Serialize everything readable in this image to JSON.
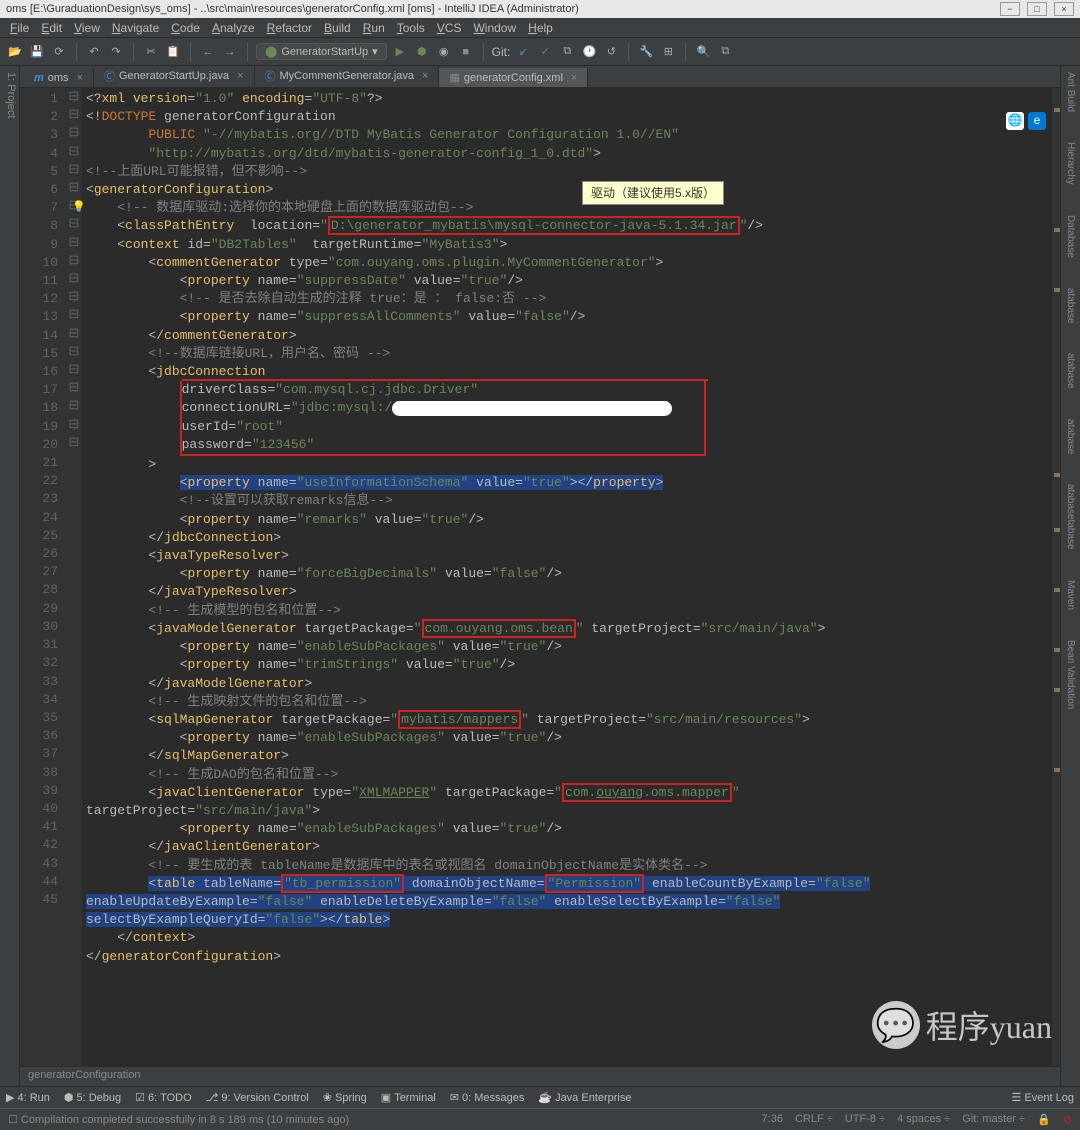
{
  "window": {
    "title": "oms [E:\\GuraduationDesign\\sys_oms] - ..\\src\\main\\resources\\generatorConfig.xml [oms] - IntelliJ IDEA (Administrator)"
  },
  "menu": [
    "File",
    "Edit",
    "View",
    "Navigate",
    "Code",
    "Analyze",
    "Refactor",
    "Build",
    "Run",
    "Tools",
    "VCS",
    "Window",
    "Help"
  ],
  "run_config": "GeneratorStartUp",
  "git_label": "Git:",
  "tabs": [
    {
      "label": "oms",
      "icon": "m",
      "active": false
    },
    {
      "label": "GeneratorStartUp.java",
      "icon": "c",
      "active": false
    },
    {
      "label": "MyCommentGenerator.java",
      "icon": "c",
      "active": false
    },
    {
      "label": "generatorConfig.xml",
      "icon": "x",
      "active": true
    }
  ],
  "annotation1": "驱动（建议使用5.x版）",
  "code_lines": [
    {
      "n": 1,
      "html": "<span class='a'>&lt;?</span><span class='t'>xml version</span><span class='a'>=</span><span class='v'>\"1.0\"</span> <span class='t'>encoding</span><span class='a'>=</span><span class='v'>\"UTF-8\"</span><span class='a'>?&gt;</span>"
    },
    {
      "n": 2,
      "html": "<span class='a'>&lt;!</span><span class='d'>DOCTYPE</span> <span class='a'>generatorConfiguration</span>"
    },
    {
      "n": 3,
      "html": "        <span class='d'>PUBLIC</span> <span class='v'>\"-//mybatis.org//DTD MyBatis Generator Configuration 1.0//EN\"</span>"
    },
    {
      "n": 4,
      "html": "        <span class='v'>\"http://mybatis.org/dtd/mybatis-generator-config_1_0.dtd\"</span><span class='a'>&gt;</span>"
    },
    {
      "n": 5,
      "html": "<span class='c'>&lt;!--上面URL可能报错，但不影响--&gt;</span>"
    },
    {
      "n": 6,
      "html": "<span class='a'>&lt;</span><span class='t'>generatorConfiguration</span><span class='a'>&gt;</span>"
    },
    {
      "n": 7,
      "html": "    <span class='c'>&lt;!-- 数据库驱动:选择你的本地硬盘上面的数据库驱动包--&gt;</span>",
      "bulb": true
    },
    {
      "n": 8,
      "html": "    <span class='a'>&lt;</span><span class='t'>classPathEntry</span>  <span class='a'>location=</span><span class='v'>\"</span><span class='box-r'><span class='v'>D:\\generator_mybatis\\mysql-connector-java-5.1.34.jar</span></span><span class='v'>\"</span><span class='a'>/&gt;</span>"
    },
    {
      "n": 9,
      "html": "    <span class='a'>&lt;</span><span class='t'>context</span> <span class='a'>id=</span><span class='v'>\"DB2Tables\"</span>  <span class='a'>targetRuntime=</span><span class='v'>\"MyBatis3\"</span><span class='a'>&gt;</span>"
    },
    {
      "n": 10,
      "html": "        <span class='a'>&lt;</span><span class='t'>commentGenerator</span> <span class='a'>type=</span><span class='v'>\"com.ouyang.oms.plugin.MyCommentGenerator\"</span><span class='a'>&gt;</span>"
    },
    {
      "n": 11,
      "html": "            <span class='a'>&lt;</span><span class='t'>property</span> <span class='a'>name=</span><span class='v'>\"suppressDate\"</span> <span class='a'>value=</span><span class='v'>\"true\"</span><span class='a'>/&gt;</span>"
    },
    {
      "n": 12,
      "html": "            <span class='c'>&lt;!-- 是否去除自动生成的注释 true：是 ： false:否 --&gt;</span>"
    },
    {
      "n": 13,
      "html": "            <span class='a'>&lt;</span><span class='t'>property</span> <span class='a'>name=</span><span class='v'>\"suppressAllComments\"</span> <span class='a'>value=</span><span class='v'>\"false\"</span><span class='a'>/&gt;</span>"
    },
    {
      "n": 14,
      "html": "        <span class='a'>&lt;/</span><span class='t'>commentGenerator</span><span class='a'>&gt;</span>"
    },
    {
      "n": 15,
      "html": "        <span class='c'>&lt;!--数据库链接URL，用户名、密码 --&gt;</span>"
    },
    {
      "n": 16,
      "html": "        <span class='a'>&lt;</span><span class='t'>jdbcConnection</span>",
      "box_start": true
    },
    {
      "n": 17,
      "html": "            <span style='display:inline-block;border-left:2px solid #c22;border-right:2px solid #c22;width:526px'><span class='a'>driverClass=</span><span class='v'>\"com.mysql.cj.jdbc.Driver\"</span></span>"
    },
    {
      "n": 18,
      "html": "            <span style='display:inline-block;border-left:2px solid #c22;border-right:2px solid #c22;width:526px'><span class='a'>connectionURL=</span><span class='v'>\"jdbc:mysql:/</span><span class='white-blob' style='width:280px;height:15px;vertical-align:middle'></span></span>"
    },
    {
      "n": 19,
      "html": "            <span style='display:inline-block;border-left:2px solid #c22;border-right:2px solid #c22;width:526px'><span class='a'>userId=</span><span class='v'>\"root\"</span></span>"
    },
    {
      "n": 20,
      "html": "            <span style='display:inline-block;border:2px solid #c22;border-top:none;width:526px'><span class='a'>password=</span><span class='v'>\"123456\"</span></span>"
    },
    {
      "n": 21,
      "html": "        <span class='a'>&gt;</span>"
    },
    {
      "n": 22,
      "html": "            <span class='hi'><span class='a'>&lt;</span><span class='t'>property</span> <span class='a'>name=</span><span class='v'>\"useInformationSchema\"</span> <span class='a'>value=</span><span class='v'>\"true\"</span><span class='a'>&gt;&lt;/</span><span class='t'>property</span><span class='a'>&gt;</span></span>"
    },
    {
      "n": 23,
      "html": "            <span class='c'>&lt;!--设置可以获取remarks信息--&gt;</span>"
    },
    {
      "n": 24,
      "html": "            <span class='a'>&lt;</span><span class='t'>property</span> <span class='a'>name=</span><span class='v'>\"remarks\"</span> <span class='a'>value=</span><span class='v'>\"true\"</span><span class='a'>/&gt;</span>"
    },
    {
      "n": 25,
      "html": "        <span class='a'>&lt;/</span><span class='t'>jdbcConnection</span><span class='a'>&gt;</span>"
    },
    {
      "n": 26,
      "html": "        <span class='a'>&lt;</span><span class='t'>javaTypeResolver</span><span class='a'>&gt;</span>"
    },
    {
      "n": 27,
      "html": "            <span class='a'>&lt;</span><span class='t'>property</span> <span class='a'>name=</span><span class='v'>\"forceBigDecimals\"</span> <span class='a'>value=</span><span class='v'>\"false\"</span><span class='a'>/&gt;</span>"
    },
    {
      "n": 28,
      "html": "        <span class='a'>&lt;/</span><span class='t'>javaTypeResolver</span><span class='a'>&gt;</span>"
    },
    {
      "n": 29,
      "html": "        <span class='c'>&lt;!-- 生成模型的包名和位置--&gt;</span>"
    },
    {
      "n": 30,
      "html": "        <span class='a'>&lt;</span><span class='t'>javaModelGenerator</span> <span class='a'>targetPackage=</span><span class='v'>\"</span><span class='box-r'><span class='v'>com.ouyang.oms.bean</span></span><span class='v'>\"</span> <span class='a'>targetProject=</span><span class='v'>\"src/main/java\"</span><span class='a'>&gt;</span>"
    },
    {
      "n": 31,
      "html": "            <span class='a'>&lt;</span><span class='t'>property</span> <span class='a'>name=</span><span class='v'>\"enableSubPackages\"</span> <span class='a'>value=</span><span class='v'>\"true\"</span><span class='a'>/&gt;</span>"
    },
    {
      "n": 32,
      "html": "            <span class='a'>&lt;</span><span class='t'>property</span> <span class='a'>name=</span><span class='v'>\"trimStrings\"</span> <span class='a'>value=</span><span class='v'>\"true\"</span><span class='a'>/&gt;</span>"
    },
    {
      "n": 33,
      "html": "        <span class='a'>&lt;/</span><span class='t'>javaModelGenerator</span><span class='a'>&gt;</span>"
    },
    {
      "n": 34,
      "html": "        <span class='c'>&lt;!-- 生成映射文件的包名和位置--&gt;</span>"
    },
    {
      "n": 35,
      "html": "        <span class='a'>&lt;</span><span class='t'>sqlMapGenerator</span> <span class='a'>targetPackage=</span><span class='v'>\"</span><span class='box-r'><span class='v'>mybatis/mappers</span></span><span class='v'>\"</span> <span class='a'>targetProject=</span><span class='v'>\"src/main/resources\"</span><span class='a'>&gt;</span>"
    },
    {
      "n": 36,
      "html": "            <span class='a'>&lt;</span><span class='t'>property</span> <span class='a'>name=</span><span class='v'>\"enableSubPackages\"</span> <span class='a'>value=</span><span class='v'>\"true\"</span><span class='a'>/&gt;</span>"
    },
    {
      "n": 37,
      "html": "        <span class='a'>&lt;/</span><span class='t'>sqlMapGenerator</span><span class='a'>&gt;</span>"
    },
    {
      "n": 38,
      "html": "        <span class='c'>&lt;!-- 生成DAO的包名和位置--&gt;</span>"
    },
    {
      "n": 39,
      "html": "        <span class='a'>&lt;</span><span class='t'>javaClientGenerator</span> <span class='a'>type=</span><span class='v'>\"<u>XMLMAPPER</u>\"</span> <span class='a'>targetPackage=</span><span class='v'>\"</span><span class='box-r'><span class='v'>com.<u>ouyang</u>.oms.mapper</span></span><span class='v'>\"</span>"
    },
    {
      "n": null,
      "ex": true,
      "html": "<span class='a'>targetProject=</span><span class='v'>\"src/main/java\"</span><span class='a'>&gt;</span>"
    },
    {
      "n": 40,
      "html": "            <span class='a'>&lt;</span><span class='t'>property</span> <span class='a'>name=</span><span class='v'>\"enableSubPackages\"</span> <span class='a'>value=</span><span class='v'>\"true\"</span><span class='a'>/&gt;</span>"
    },
    {
      "n": 41,
      "html": "        <span class='a'>&lt;/</span><span class='t'>javaClientGenerator</span><span class='a'>&gt;</span>"
    },
    {
      "n": 42,
      "html": "        <span class='c'>&lt;!-- 要生成的表 tableName是数据库中的表名或视图名 domainObjectName是实体类名--&gt;</span>"
    },
    {
      "n": 43,
      "html": "        <span class='hi'><span class='a'>&lt;</span><span class='t'>table</span> <span class='a'>tableName=</span><span class='box-r'><span class='v'>\"tb_permission\"</span></span> <span class='a'>domainObjectName=</span><span class='box-r'><span class='v'>\"Permission\"</span></span> <span class='a'>enableCountByExample=</span><span class='v'>\"false\"</span></span>"
    },
    {
      "n": null,
      "ex": true,
      "html": "<span class='hi'><span class='a'>enableUpdateByExample=</span><span class='v'>\"false\"</span> <span class='a'>enableDeleteByExample=</span><span class='v'>\"false\"</span> <span class='a'>enableSelectByExample=</span><span class='v'>\"false\"</span></span>"
    },
    {
      "n": null,
      "ex": true,
      "html": "<span class='hi'><span class='a'>selectByExampleQueryId=</span><span class='v'>\"false\"</span><span class='a'>&gt;&lt;/</span><span class='t'>table</span><span class='a'>&gt;</span></span>"
    },
    {
      "n": 44,
      "html": "    <span class='a'>&lt;/</span><span class='t'>context</span><span class='a'>&gt;</span>"
    },
    {
      "n": 45,
      "html": "<span class='a'>&lt;/</span><span class='t'>generatorConfiguration</span><span class='a'>&gt;</span>"
    }
  ],
  "breadcrumb": "generatorConfiguration",
  "bottom_items": [
    {
      "icon": "▶",
      "label": "4: Run"
    },
    {
      "icon": "⬢",
      "label": "5: Debug"
    },
    {
      "icon": "☑",
      "label": "6: TODO"
    },
    {
      "icon": "⎇",
      "label": "9: Version Control"
    },
    {
      "icon": "❀",
      "label": "Spring"
    },
    {
      "icon": "▣",
      "label": "Terminal"
    },
    {
      "icon": "✉",
      "label": "0: Messages"
    },
    {
      "icon": "☕",
      "label": "Java Enterprise"
    }
  ],
  "event_log": "Event Log",
  "status": {
    "left": "Compilation completed successfully in 8 s 189 ms (10 minutes ago)",
    "pos": "7:36",
    "eol": "CRLF ÷",
    "enc": "UTF-8 ÷",
    "indent": "4 spaces ÷",
    "git": "Git: master ÷"
  },
  "left_tool": "1: Project",
  "right_tools": [
    "Ant Build",
    "Hierarchy",
    "Database",
    "atabase",
    "atabase",
    "atabase",
    "atabasetabase",
    "Maven",
    "Bean Validation"
  ],
  "watermark": "程序yuan"
}
